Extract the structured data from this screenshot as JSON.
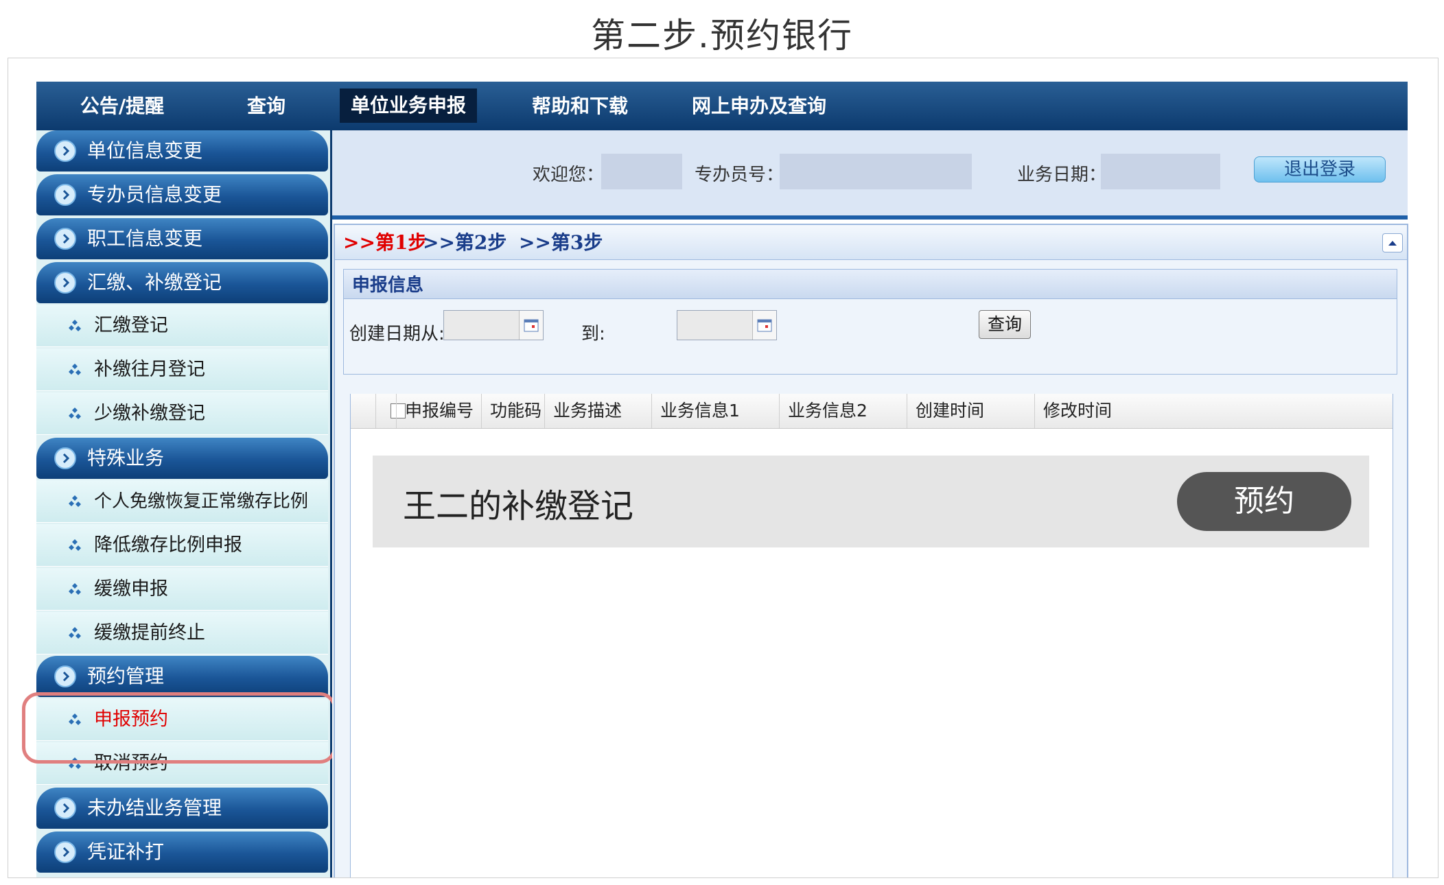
{
  "page_title": "第二步.预约银行",
  "nav": {
    "items": [
      {
        "label": "公告/提醒"
      },
      {
        "label": "查询"
      },
      {
        "label": "单位业务申报"
      },
      {
        "label": "帮助和下载"
      },
      {
        "label": "网上申办及查询"
      }
    ],
    "active_index": 2
  },
  "sidebar": {
    "groups": [
      {
        "label": "单位信息变更"
      },
      {
        "label": "专办员信息变更"
      },
      {
        "label": "职工信息变更"
      },
      {
        "label": "汇缴、补缴登记",
        "children": [
          "汇缴登记",
          "补缴往月登记",
          "少缴补缴登记"
        ]
      },
      {
        "label": "特殊业务",
        "children": [
          "个人免缴恢复正常缴存比例",
          "降低缴存比例申报",
          "缓缴申报",
          "缓缴提前终止"
        ]
      },
      {
        "label": "预约管理",
        "children": [
          "申报预约",
          "取消预约"
        ]
      },
      {
        "label": "未办结业务管理"
      },
      {
        "label": "凭证补打"
      }
    ],
    "highlighted": "申报预约",
    "colors": {
      "highlight_text": "#e00000",
      "highlight_box": "#e07f7f"
    }
  },
  "info_bar": {
    "welcome_label": "欢迎您：",
    "agent_no_label": "专办员号：",
    "business_date_label": "业务日期：",
    "logout_label": "退出登录"
  },
  "steps": {
    "step1": ">>第1步",
    "step2": ">>第2步",
    "step3": ">>第3步",
    "current_color": "#e00000"
  },
  "section": {
    "title": "申报信息",
    "date_from_label": "创建日期从:",
    "date_to_label": "到:",
    "date_from_value": "",
    "date_to_value": "",
    "query_label": "查询"
  },
  "table": {
    "columns": [
      "申报编号",
      "功能码",
      "业务描述",
      "业务信息1",
      "业务信息2",
      "创建时间",
      "修改时间"
    ]
  },
  "record": {
    "title": "王二的补缴登记",
    "action": "预约"
  }
}
